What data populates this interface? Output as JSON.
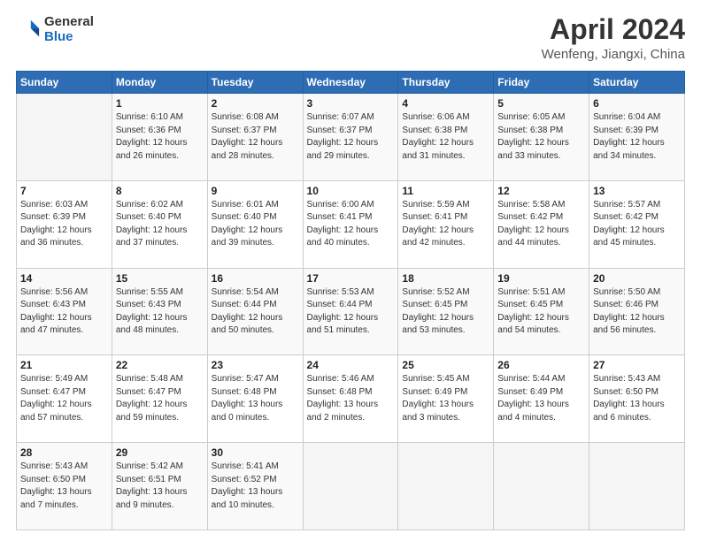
{
  "logo": {
    "line1": "General",
    "line2": "Blue"
  },
  "title": "April 2024",
  "subtitle": "Wenfeng, Jiangxi, China",
  "header_days": [
    "Sunday",
    "Monday",
    "Tuesday",
    "Wednesday",
    "Thursday",
    "Friday",
    "Saturday"
  ],
  "weeks": [
    [
      {
        "day": "",
        "info": ""
      },
      {
        "day": "1",
        "info": "Sunrise: 6:10 AM\nSunset: 6:36 PM\nDaylight: 12 hours\nand 26 minutes."
      },
      {
        "day": "2",
        "info": "Sunrise: 6:08 AM\nSunset: 6:37 PM\nDaylight: 12 hours\nand 28 minutes."
      },
      {
        "day": "3",
        "info": "Sunrise: 6:07 AM\nSunset: 6:37 PM\nDaylight: 12 hours\nand 29 minutes."
      },
      {
        "day": "4",
        "info": "Sunrise: 6:06 AM\nSunset: 6:38 PM\nDaylight: 12 hours\nand 31 minutes."
      },
      {
        "day": "5",
        "info": "Sunrise: 6:05 AM\nSunset: 6:38 PM\nDaylight: 12 hours\nand 33 minutes."
      },
      {
        "day": "6",
        "info": "Sunrise: 6:04 AM\nSunset: 6:39 PM\nDaylight: 12 hours\nand 34 minutes."
      }
    ],
    [
      {
        "day": "7",
        "info": "Sunrise: 6:03 AM\nSunset: 6:39 PM\nDaylight: 12 hours\nand 36 minutes."
      },
      {
        "day": "8",
        "info": "Sunrise: 6:02 AM\nSunset: 6:40 PM\nDaylight: 12 hours\nand 37 minutes."
      },
      {
        "day": "9",
        "info": "Sunrise: 6:01 AM\nSunset: 6:40 PM\nDaylight: 12 hours\nand 39 minutes."
      },
      {
        "day": "10",
        "info": "Sunrise: 6:00 AM\nSunset: 6:41 PM\nDaylight: 12 hours\nand 40 minutes."
      },
      {
        "day": "11",
        "info": "Sunrise: 5:59 AM\nSunset: 6:41 PM\nDaylight: 12 hours\nand 42 minutes."
      },
      {
        "day": "12",
        "info": "Sunrise: 5:58 AM\nSunset: 6:42 PM\nDaylight: 12 hours\nand 44 minutes."
      },
      {
        "day": "13",
        "info": "Sunrise: 5:57 AM\nSunset: 6:42 PM\nDaylight: 12 hours\nand 45 minutes."
      }
    ],
    [
      {
        "day": "14",
        "info": "Sunrise: 5:56 AM\nSunset: 6:43 PM\nDaylight: 12 hours\nand 47 minutes."
      },
      {
        "day": "15",
        "info": "Sunrise: 5:55 AM\nSunset: 6:43 PM\nDaylight: 12 hours\nand 48 minutes."
      },
      {
        "day": "16",
        "info": "Sunrise: 5:54 AM\nSunset: 6:44 PM\nDaylight: 12 hours\nand 50 minutes."
      },
      {
        "day": "17",
        "info": "Sunrise: 5:53 AM\nSunset: 6:44 PM\nDaylight: 12 hours\nand 51 minutes."
      },
      {
        "day": "18",
        "info": "Sunrise: 5:52 AM\nSunset: 6:45 PM\nDaylight: 12 hours\nand 53 minutes."
      },
      {
        "day": "19",
        "info": "Sunrise: 5:51 AM\nSunset: 6:45 PM\nDaylight: 12 hours\nand 54 minutes."
      },
      {
        "day": "20",
        "info": "Sunrise: 5:50 AM\nSunset: 6:46 PM\nDaylight: 12 hours\nand 56 minutes."
      }
    ],
    [
      {
        "day": "21",
        "info": "Sunrise: 5:49 AM\nSunset: 6:47 PM\nDaylight: 12 hours\nand 57 minutes."
      },
      {
        "day": "22",
        "info": "Sunrise: 5:48 AM\nSunset: 6:47 PM\nDaylight: 12 hours\nand 59 minutes."
      },
      {
        "day": "23",
        "info": "Sunrise: 5:47 AM\nSunset: 6:48 PM\nDaylight: 13 hours\nand 0 minutes."
      },
      {
        "day": "24",
        "info": "Sunrise: 5:46 AM\nSunset: 6:48 PM\nDaylight: 13 hours\nand 2 minutes."
      },
      {
        "day": "25",
        "info": "Sunrise: 5:45 AM\nSunset: 6:49 PM\nDaylight: 13 hours\nand 3 minutes."
      },
      {
        "day": "26",
        "info": "Sunrise: 5:44 AM\nSunset: 6:49 PM\nDaylight: 13 hours\nand 4 minutes."
      },
      {
        "day": "27",
        "info": "Sunrise: 5:43 AM\nSunset: 6:50 PM\nDaylight: 13 hours\nand 6 minutes."
      }
    ],
    [
      {
        "day": "28",
        "info": "Sunrise: 5:43 AM\nSunset: 6:50 PM\nDaylight: 13 hours\nand 7 minutes."
      },
      {
        "day": "29",
        "info": "Sunrise: 5:42 AM\nSunset: 6:51 PM\nDaylight: 13 hours\nand 9 minutes."
      },
      {
        "day": "30",
        "info": "Sunrise: 5:41 AM\nSunset: 6:52 PM\nDaylight: 13 hours\nand 10 minutes."
      },
      {
        "day": "",
        "info": ""
      },
      {
        "day": "",
        "info": ""
      },
      {
        "day": "",
        "info": ""
      },
      {
        "day": "",
        "info": ""
      }
    ]
  ]
}
